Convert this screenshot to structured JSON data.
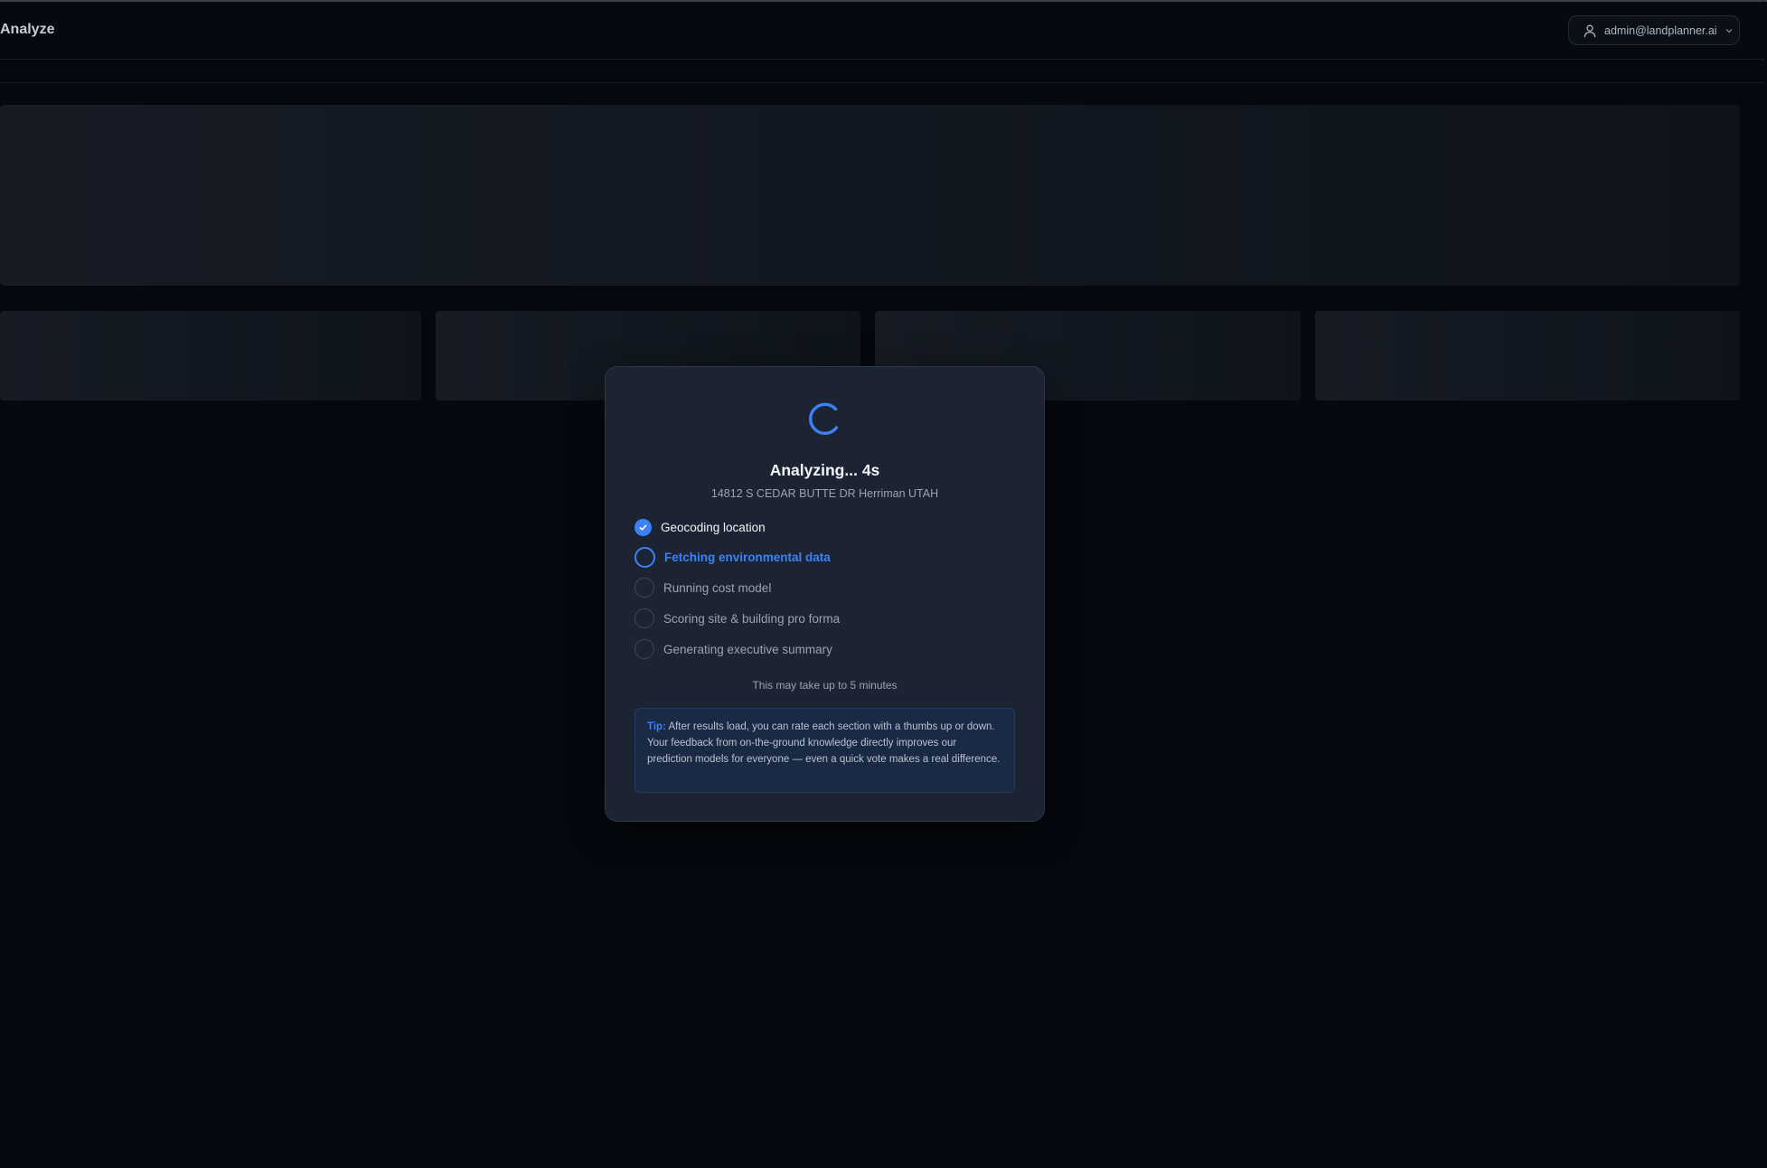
{
  "header": {
    "title": "Analyze",
    "user_email": "admin@landplanner.ai"
  },
  "modal": {
    "title": "Analyzing... 4s",
    "address": "14812 S CEDAR BUTTE DR Herriman UTAH",
    "steps": [
      {
        "label": "Geocoding location",
        "status": "done"
      },
      {
        "label": "Fetching environmental data",
        "status": "active"
      },
      {
        "label": "Running cost model",
        "status": "pending"
      },
      {
        "label": "Scoring site & building pro forma",
        "status": "pending"
      },
      {
        "label": "Generating executive summary",
        "status": "pending"
      }
    ],
    "wait_note": "This may take up to 5 minutes",
    "tip_label": "Tip:",
    "tip_text": "After results load, you can rate each section with a thumbs up or down. Your feedback from on-the-ground knowledge directly improves our prediction models for everyone — even a quick vote makes a real difference."
  },
  "colors": {
    "accent": "#3b82f6",
    "background": "#05080f",
    "modal_bg": "#1c2433"
  },
  "icons": {
    "user": "user-icon",
    "chevron": "chevron-down-icon",
    "spinner": "spinner-icon",
    "check": "check-icon"
  }
}
